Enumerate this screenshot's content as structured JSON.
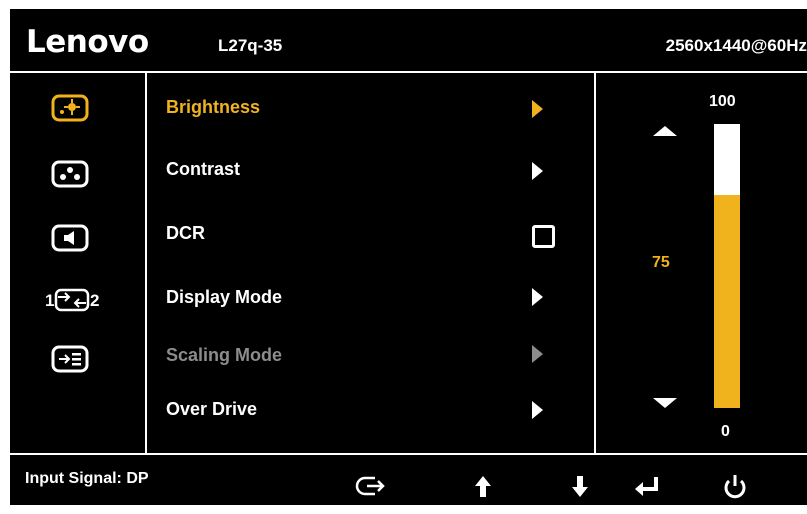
{
  "header": {
    "brand": "Lenovo",
    "model": "L27q-35",
    "resolution": "2560x1440@60Hz"
  },
  "sidebar": {
    "icons": [
      "brightness-icon",
      "color-icon",
      "audio-icon",
      "input-switch-icon",
      "menu-settings-icon"
    ],
    "active_index": 0,
    "input_switch_left": "1",
    "input_switch_right": "2"
  },
  "menu": {
    "items": [
      {
        "label": "Brightness",
        "control": "arrow",
        "state": "selected"
      },
      {
        "label": "Contrast",
        "control": "arrow",
        "state": "normal"
      },
      {
        "label": "DCR",
        "control": "checkbox",
        "state": "normal"
      },
      {
        "label": "Display Mode",
        "control": "arrow",
        "state": "normal"
      },
      {
        "label": "Scaling Mode",
        "control": "arrow",
        "state": "disabled"
      },
      {
        "label": "Over Drive",
        "control": "arrow",
        "state": "normal"
      }
    ]
  },
  "slider": {
    "max_label": "100",
    "min_label": "0",
    "value": "75",
    "fraction": 0.75
  },
  "footer": {
    "input_signal": "Input Signal: DP",
    "keys": [
      "input-source-icon",
      "arrow-up-icon",
      "arrow-down-icon",
      "enter-icon",
      "power-icon"
    ]
  },
  "colors": {
    "accent": "#f0b21d",
    "background": "#000000",
    "text": "#ffffff",
    "disabled": "#8c8c8c"
  }
}
